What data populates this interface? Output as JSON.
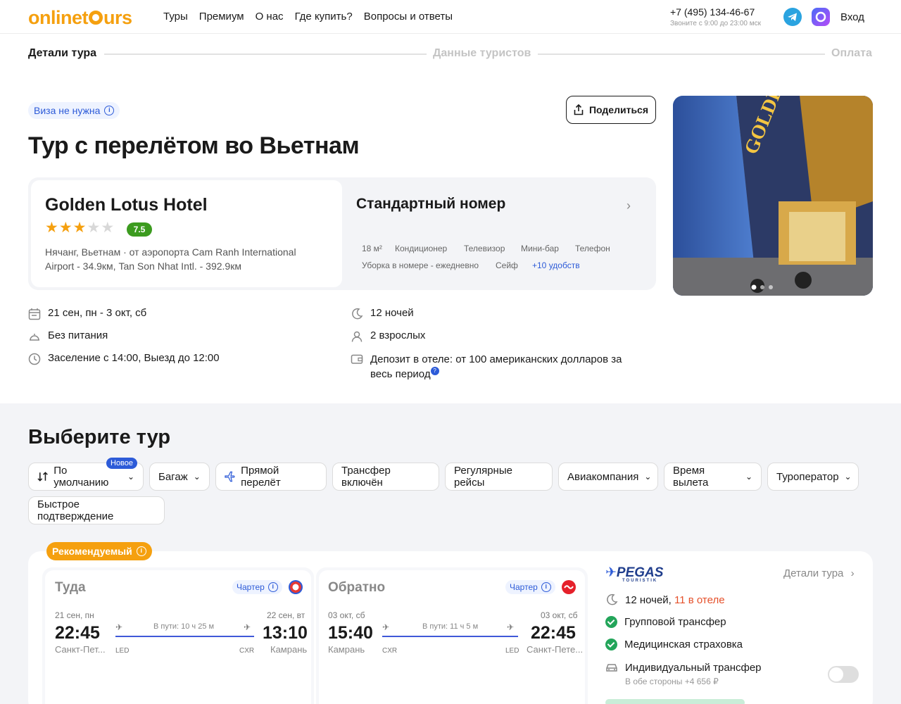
{
  "header": {
    "logo": "onlinetours",
    "nav": [
      "Туры",
      "Премиум",
      "О нас",
      "Где купить?",
      "Вопросы и ответы"
    ],
    "phone": "+7 (495) 134-46-67",
    "phone_hours": "Звоните с 9:00 до 23:00 мск",
    "login": "Вход",
    "icons": [
      "telegram-icon",
      "max-messenger-icon"
    ]
  },
  "steps": [
    "Детали тура",
    "Данные туристов",
    "Оплата"
  ],
  "tour": {
    "visa": "Виза не нужна",
    "share": "Поделиться",
    "title": "Тур с перелётом во Вьетнам",
    "hotel_name": "Golden Lotus Hotel",
    "stars": 3,
    "stars_max": 5,
    "rating": "7.5",
    "location": "Нячанг, Вьетнам · от аэропорта Cam Ranh International Airport - 34.9км, Tan Son Nhat Intl. - 392.9км",
    "room": "Стандартный номер",
    "amenities_row1": [
      "18 м²",
      "Кондиционер",
      "Телевизор",
      "Мини-бар",
      "Телефон"
    ],
    "amenities_row2": [
      "Уборка в номере - ежедневно",
      "Сейф"
    ],
    "amenities_more": "+10 удобств",
    "photo_sign": "GOLDEN LOTUS",
    "info_left": [
      "21 сен, пн - 3 окт, сб",
      "Без питания",
      "Заселение с 14:00, Выезд до 12:00"
    ],
    "info_right": [
      "12 ночей",
      "2 взрослых",
      "Депозит в отеле: от 100 американских долларов за весь период"
    ],
    "colors": {
      "accent": "#f5a00f",
      "blue": "#2d5bd8",
      "rating": "#3c9b1f"
    }
  },
  "select": {
    "title": "Выберите тур",
    "badge_new": "Новое",
    "filters_row1": [
      "По умолчанию",
      "Багаж",
      "Прямой перелёт",
      "Трансфер включён",
      "Регулярные рейсы",
      "Авиакомпания",
      "Время вылета",
      "Туроператор"
    ],
    "filters_row2": [
      "Быстрое подтверждение"
    ]
  },
  "offer": {
    "recommended": "Рекомендуемый",
    "outbound": {
      "label": "Туда",
      "charter": "Чартер",
      "dep_date": "21 сен, пн",
      "dep_time": "22:45",
      "dep_city": "Санкт-Пет...",
      "dep_code": "LED",
      "arr_date": "22 сен, вт",
      "arr_time": "13:10",
      "arr_city": "Камрань",
      "arr_code": "CXR",
      "duration": "В пути: 10 ч 25 м"
    },
    "inbound": {
      "label": "Обратно",
      "charter": "Чартер",
      "dep_date": "03 окт, сб",
      "dep_time": "15:40",
      "dep_city": "Камрань",
      "dep_code": "CXR",
      "arr_date": "03 окт, сб",
      "arr_time": "22:45",
      "arr_city": "Санкт-Пете...",
      "arr_code": "LED",
      "duration": "В пути: 11 ч 5 м"
    },
    "operator": "PEGAS",
    "operator_sub": "TOURISTIK",
    "details": "Детали тура",
    "nights": "12 ночей,",
    "nights_hotel": "11 в отеле",
    "options": [
      "Групповой трансфер",
      "Медицинская страховка"
    ],
    "individual": "Индивидуальный трансфер",
    "individual_price": "В обе стороны +4 656 ₽"
  }
}
